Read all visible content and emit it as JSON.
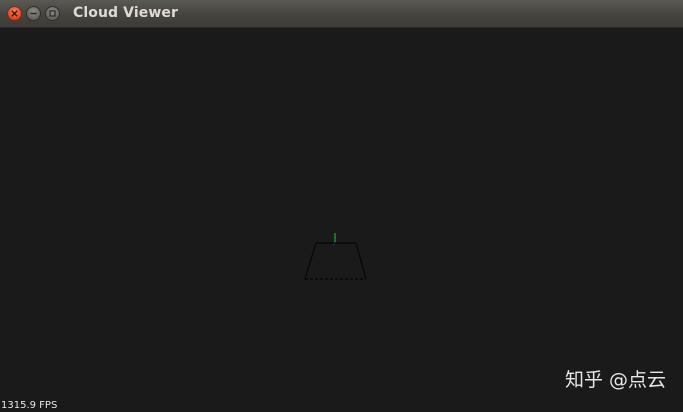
{
  "window": {
    "title": "Cloud Viewer",
    "controls": {
      "close_icon": "close-icon",
      "minimize_icon": "minimize-icon",
      "maximize_icon": "maximize-icon"
    }
  },
  "viewer": {
    "background_color": "#1a1a1a",
    "fps_text": "1315.9 FPS",
    "axes_colors": {
      "x": "#cc2222",
      "y": "#22cc22",
      "z": "#2222cc"
    }
  },
  "watermark": {
    "text": "知乎 @点云"
  }
}
